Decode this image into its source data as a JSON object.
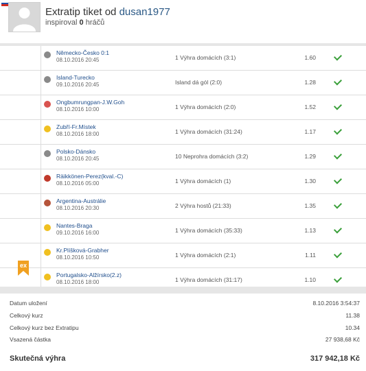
{
  "header": {
    "title_prefix": "Extratip tiket od",
    "username": "dusan1977",
    "inspired_prefix": "inspiroval",
    "inspired_count": "0",
    "inspired_suffix": "hráčů",
    "flag_colors": [
      "#ffffff",
      "#1f4fa8",
      "#d52b1e"
    ]
  },
  "bets": [
    {
      "match": "Německo-Česko 0:1",
      "date": "08.10.2016 20:45",
      "tip": "1 Výhra domácích (3:1)",
      "odd": "1.60",
      "sport_icon": "soccer-ball-icon",
      "sport_color": "#8a8a8a"
    },
    {
      "match": "Island-Turecko",
      "date": "09.10.2016 20:45",
      "tip": "Island dá gól (2:0)",
      "odd": "1.28",
      "sport_icon": "soccer-ball-icon",
      "sport_color": "#8a8a8a"
    },
    {
      "match": "Ongbumrungpan-J.W.Goh",
      "date": "08.10.2016 10:00",
      "tip": "1 Výhra domácích (2:0)",
      "odd": "1.52",
      "sport_icon": "badminton-icon",
      "sport_color": "#d9534f"
    },
    {
      "match": "Zubří-Fr.Místek",
      "date": "08.10.2016 18:00",
      "tip": "1 Výhra domácích (31:24)",
      "odd": "1.17",
      "sport_icon": "handball-icon",
      "sport_color": "#f0c020"
    },
    {
      "match": "Polsko-Dánsko",
      "date": "08.10.2016 20:45",
      "tip": "10 Neprohra domácích (3:2)",
      "odd": "1.29",
      "sport_icon": "soccer-ball-icon",
      "sport_color": "#8a8a8a"
    },
    {
      "match": "Räikkönen-Perez(kval.-C)",
      "date": "08.10.2016 05:00",
      "tip": "1 Výhra domácích (1)",
      "odd": "1.30",
      "sport_icon": "formula-car-icon",
      "sport_color": "#c0392b"
    },
    {
      "match": "Argentina-Austrálie",
      "date": "08.10.2016 20:30",
      "tip": "2 Výhra hostů (21:33)",
      "odd": "1.35",
      "sport_icon": "rugby-ball-icon",
      "sport_color": "#b5543a"
    },
    {
      "match": "Nantes-Braga",
      "date": "09.10.2016 16:00",
      "tip": "1 Výhra domácích (35:33)",
      "odd": "1.13",
      "sport_icon": "handball-icon",
      "sport_color": "#f0c020"
    },
    {
      "match": "Kr.Plíšková-Grabher",
      "date": "08.10.2016 10:50",
      "tip": "1 Výhra domácích (2:1)",
      "odd": "1.11",
      "sport_icon": "tennis-ball-icon",
      "sport_color": "#f0c020"
    },
    {
      "match": "Portugalsko-Alžírsko(2.z)",
      "date": "08.10.2016 18:00",
      "tip": "1 Výhra domácích (31:17)",
      "odd": "1.10",
      "sport_icon": "handball-icon",
      "sport_color": "#f0c020"
    }
  ],
  "extratip_badge": "ex",
  "summary": {
    "saved_label": "Datum uložení",
    "saved_value": "8.10.2016 3:54:37",
    "total_odds_label": "Celkový kurz",
    "total_odds_value": "11.38",
    "odds_no_extra_label": "Celkový kurz bez Extratipu",
    "odds_no_extra_value": "10.34",
    "stake_label": "Vsazená částka",
    "stake_value": "27 938,68 Kč",
    "win_label": "Skutečná výhra",
    "win_value": "317 942,18 Kč"
  },
  "colors": {
    "link": "#1f4e8c",
    "check": "#3a9f3a",
    "extratip": "#f0a020"
  }
}
